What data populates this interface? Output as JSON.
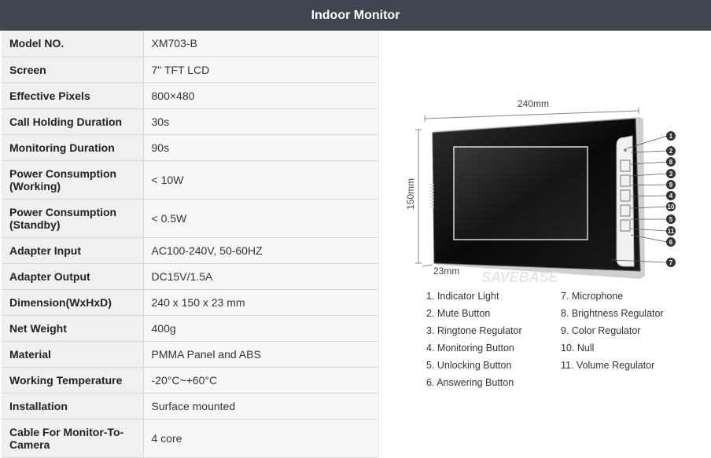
{
  "header": {
    "title": "Indoor Monitor"
  },
  "specs": [
    {
      "key": "Model NO.",
      "value": "XM703-B"
    },
    {
      "key": "Screen",
      "value": "7\" TFT LCD"
    },
    {
      "key": "Effective Pixels",
      "value": "800×480"
    },
    {
      "key": "Call Holding Duration",
      "value": "30s"
    },
    {
      "key": "Monitoring Duration",
      "value": "90s"
    },
    {
      "key": "Power Consumption (Working)",
      "value": "< 10W"
    },
    {
      "key": "Power Consumption (Standby)",
      "value": "< 0.5W"
    },
    {
      "key": "Adapter Input",
      "value": "AC100-240V, 50-60HZ"
    },
    {
      "key": "Adapter Output",
      "value": "DC15V/1.5A"
    },
    {
      "key": "Dimension(WxHxD)",
      "value": "240 x 150 x 23 mm"
    },
    {
      "key": "Net Weight",
      "value": "400g"
    },
    {
      "key": "Material",
      "value": "PMMA Panel and ABS"
    },
    {
      "key": "Working Temperature",
      "value": "-20°C~+60°C"
    },
    {
      "key": "Installation",
      "value": "Surface mounted"
    },
    {
      "key": "Cable For Monitor-To-Camera",
      "value": "4 core"
    }
  ],
  "diagram": {
    "width_label": "240mm",
    "height_label": "150mm",
    "depth_label": "23mm",
    "watermark": "SAVEBASE",
    "callouts": [
      "1",
      "2",
      "8",
      "3",
      "9",
      "4",
      "10",
      "5",
      "11",
      "6",
      "7"
    ]
  },
  "legend_left": [
    "1. Indicator Light",
    "2. Mute Button",
    "3. Ringtone Regulator",
    "4. Monitoring Button",
    "5. Unlocking Button",
    "6. Answering Button"
  ],
  "legend_right": [
    "7. Microphone",
    "8. Brightness Regulator",
    "9. Color Regulator",
    "10. Null",
    "11. Volume Regulator"
  ]
}
